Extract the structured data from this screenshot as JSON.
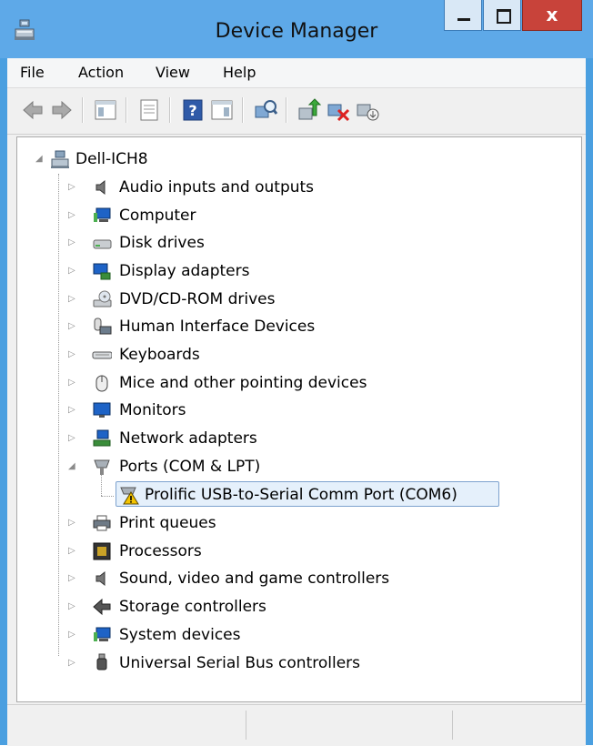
{
  "window": {
    "title": "Device Manager",
    "close_label": "x"
  },
  "menu": [
    {
      "label": "File"
    },
    {
      "label": "Action"
    },
    {
      "label": "View"
    },
    {
      "label": "Help"
    }
  ],
  "toolbar": {
    "icons": [
      "back-icon",
      "forward-icon",
      "show-hide-console-tree-icon",
      "properties-icon",
      "help-icon",
      "action-pane-icon",
      "scan-hardware-icon",
      "update-driver-icon",
      "uninstall-device-icon",
      "disable-device-icon"
    ]
  },
  "tree": {
    "root": "Dell-ICH8",
    "categories": [
      {
        "label": "Audio inputs and outputs",
        "icon": "speaker-icon"
      },
      {
        "label": "Computer",
        "icon": "computer-icon"
      },
      {
        "label": "Disk drives",
        "icon": "disk-drive-icon"
      },
      {
        "label": "Display adapters",
        "icon": "display-adapter-icon"
      },
      {
        "label": "DVD/CD-ROM drives",
        "icon": "dvd-drive-icon"
      },
      {
        "label": "Human Interface Devices",
        "icon": "hid-icon"
      },
      {
        "label": "Keyboards",
        "icon": "keyboard-icon"
      },
      {
        "label": "Mice and other pointing devices",
        "icon": "mouse-icon"
      },
      {
        "label": "Monitors",
        "icon": "monitor-icon"
      },
      {
        "label": "Network adapters",
        "icon": "network-adapter-icon"
      },
      {
        "label": "Ports (COM & LPT)",
        "icon": "port-icon"
      },
      {
        "label": "Prolific USB-to-Serial Comm Port (COM6)",
        "icon": "port-warning-icon"
      },
      {
        "label": "Print queues",
        "icon": "printer-icon"
      },
      {
        "label": "Processors",
        "icon": "processor-icon"
      },
      {
        "label": "Sound, video and game controllers",
        "icon": "speaker-icon"
      },
      {
        "label": "Storage controllers",
        "icon": "storage-controller-icon"
      },
      {
        "label": "System devices",
        "icon": "system-device-icon"
      },
      {
        "label": "Universal Serial Bus controllers",
        "icon": "usb-icon"
      }
    ]
  },
  "colors": {
    "titlebar": "#5ea9e8",
    "close_button": "#c8433a",
    "selection": "#e5f0fb",
    "selection_border": "#7da2ce"
  }
}
